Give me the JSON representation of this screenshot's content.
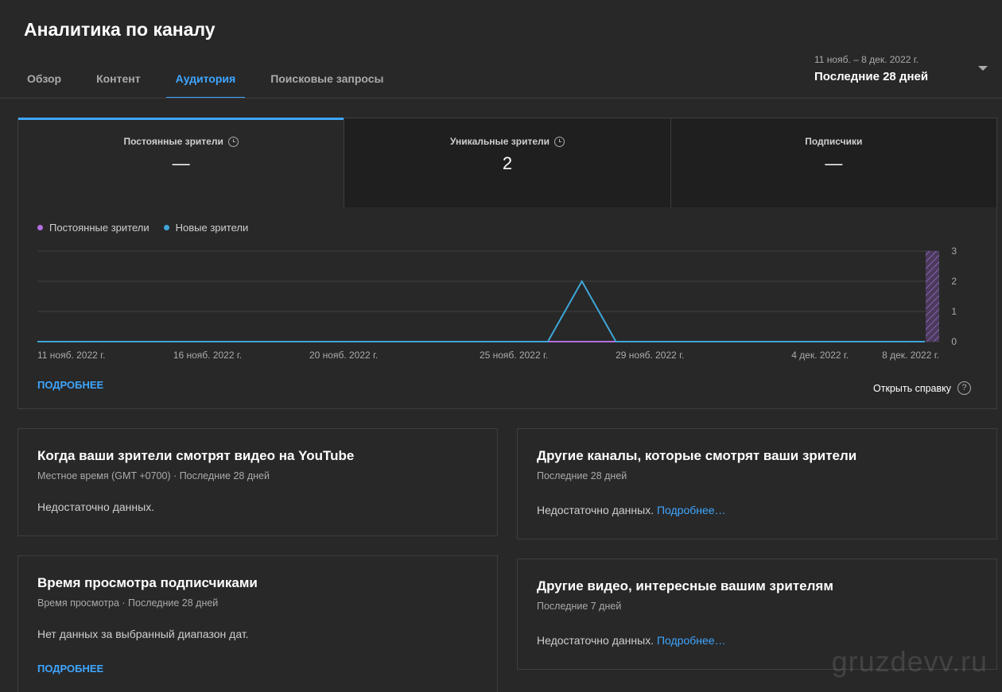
{
  "header": {
    "title": "Аналитика по каналу",
    "date_range_sub": "11 нояб. – 8 дек. 2022 г.",
    "date_range_main": "Последние 28 дней"
  },
  "tabs": [
    {
      "label": "Обзор",
      "active": false
    },
    {
      "label": "Контент",
      "active": false
    },
    {
      "label": "Аудитория",
      "active": true
    },
    {
      "label": "Поисковые запросы",
      "active": false
    }
  ],
  "metrics": [
    {
      "label": "Постоянные зрители",
      "value": "—",
      "has_clock": true
    },
    {
      "label": "Уникальные зрители",
      "value": "2",
      "has_clock": true
    },
    {
      "label": "Подписчики",
      "value": "—",
      "has_clock": false
    }
  ],
  "chart_data": {
    "type": "line",
    "series": [
      {
        "name": "Постоянные зрители",
        "color": "#b36ee0",
        "values": [
          0,
          0,
          0,
          0,
          0,
          0,
          0,
          0,
          0,
          0,
          0,
          0,
          0,
          0,
          0,
          0,
          0,
          0,
          0,
          0,
          0,
          0,
          0,
          0,
          0,
          0,
          0,
          0
        ]
      },
      {
        "name": "Новые зрители",
        "color": "#3ea6d8",
        "values": [
          0,
          0,
          0,
          0,
          0,
          0,
          0,
          0,
          0,
          0,
          0,
          0,
          0,
          0,
          0,
          0,
          2,
          0,
          0,
          0,
          0,
          0,
          0,
          0,
          0,
          0,
          0,
          0
        ]
      }
    ],
    "x_labels": [
      "11 нояб. 2022 г.",
      "16 нояб. 2022 г.",
      "20 нояб. 2022 г.",
      "25 нояб. 2022 г.",
      "29 нояб. 2022 г.",
      "4 дек. 2022 г.",
      "8 дек. 2022 г."
    ],
    "x_label_days": [
      0,
      5,
      9,
      14,
      18,
      23,
      27
    ],
    "y_ticks": [
      "0",
      "1",
      "2",
      "3"
    ],
    "ylim": [
      0,
      3
    ],
    "days": 28,
    "incomplete_last_day": true
  },
  "links": {
    "more": "ПОДРОБНЕЕ",
    "help": "Открыть справку",
    "help_icon": "?"
  },
  "cards": {
    "when_watch": {
      "title": "Когда ваши зрители смотрят видео на YouTube",
      "sub": "Местное время (GMT +0700) · Последние 28 дней",
      "text": "Недостаточно данных."
    },
    "other_channels": {
      "title": "Другие каналы, которые смотрят ваши зрители",
      "sub": "Последние 28 дней",
      "text": "Недостаточно данных.",
      "link": "Подробнее…"
    },
    "subscriber_watch_time": {
      "title": "Время просмотра подписчиками",
      "sub": "Время просмотра · Последние 28 дней",
      "text": "Нет данных за выбранный диапазон дат.",
      "more": "ПОДРОБНЕЕ"
    },
    "other_videos": {
      "title": "Другие видео, интересные вашим зрителям",
      "sub": "Последние 7 дней",
      "text": "Недостаточно данных.",
      "link": "Подробнее…"
    }
  },
  "watermark": "gruzdevv.ru",
  "icons": {
    "clock": "clock-icon",
    "help": "help-circle-icon",
    "dropdown": "arrow-drop-down-icon"
  }
}
